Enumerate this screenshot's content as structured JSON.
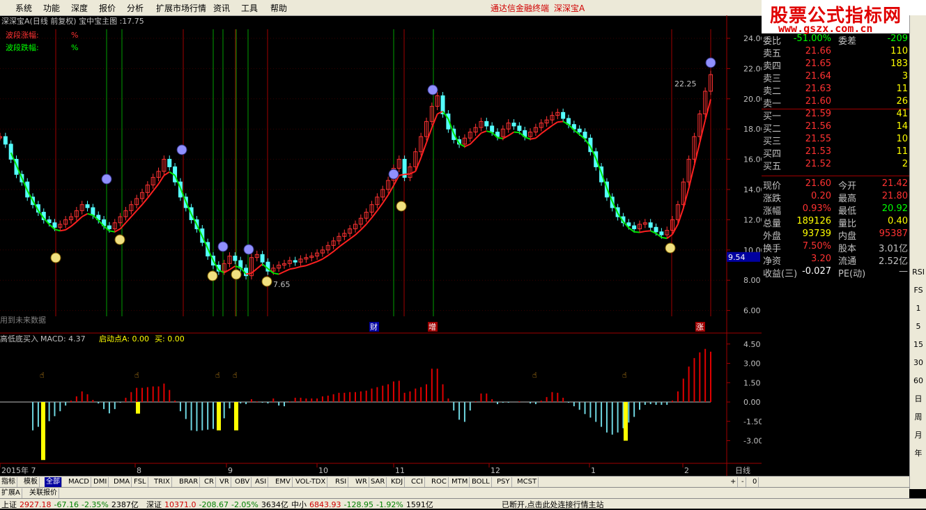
{
  "menu": [
    "系统",
    "功能",
    "深度",
    "报价",
    "分析",
    "扩展市场行情",
    "资讯",
    "工具",
    "帮助"
  ],
  "menu_center": [
    "通达信金融终端",
    "深深宝A"
  ],
  "logo": {
    "title": "股票公式指标网",
    "url": "www.gszx.com.cn"
  },
  "chart_title": "深深宝A(日线 前复权) 宝中宝主图 :17.75",
  "indicator_labels": [
    {
      "label": "波段涨幅:",
      "value": "%"
    },
    {
      "label": "波段跌幅:",
      "value": "%"
    }
  ],
  "future_data_note": "用到未来数据",
  "price_axis": [
    "24.00",
    "22.00",
    "20.00",
    "18.00",
    "16.00",
    "14.00",
    "12.00",
    "10.00",
    "8.00",
    "6.00"
  ],
  "current_price_tag": "9.54",
  "high_label": "22.25",
  "low_label": "7.65",
  "bottom_markers": [
    "财",
    "增",
    "涨"
  ],
  "sub_title": {
    "name": "高低底买入",
    "macd": "MACD: 4.37",
    "start": "启动点A: 0.00",
    "buy": "买: 0.00"
  },
  "sub_axis": [
    "4.50",
    "3.00",
    "1.50",
    "0.00",
    "-1.50",
    "-3.00"
  ],
  "date_axis": [
    "2015年 7",
    "8",
    "9",
    "10",
    "11",
    "12",
    "1",
    "2"
  ],
  "period_label": "日线",
  "quote_rows": [
    {
      "l": "委比",
      "v": "-51.00%",
      "r": "委差",
      "rv": "-209"
    },
    {
      "l": "卖五",
      "v": "21.66",
      "n": "110"
    },
    {
      "l": "卖四",
      "v": "21.65",
      "n": "183"
    },
    {
      "l": "卖三",
      "v": "21.64",
      "n": "3"
    },
    {
      "l": "卖二",
      "v": "21.63",
      "n": "11"
    },
    {
      "l": "卖一",
      "v": "21.60",
      "n": "26"
    },
    {
      "l": "买一",
      "v": "21.59",
      "n": "41"
    },
    {
      "l": "买二",
      "v": "21.56",
      "n": "14"
    },
    {
      "l": "买三",
      "v": "21.55",
      "n": "10"
    },
    {
      "l": "买四",
      "v": "21.53",
      "n": "11"
    },
    {
      "l": "买五",
      "v": "21.52",
      "n": "2"
    }
  ],
  "stats_rows": [
    {
      "l": "现价",
      "v": "21.60",
      "r": "今开",
      "rv": "21.42"
    },
    {
      "l": "涨跌",
      "v": "0.20",
      "r": "最高",
      "rv": "21.80"
    },
    {
      "l": "涨幅",
      "v": "0.93%",
      "r": "最低",
      "rv": "20.92"
    },
    {
      "l": "总量",
      "v": "189126",
      "r": "量比",
      "rv": "0.40"
    },
    {
      "l": "外盘",
      "v": "93739",
      "r": "内盘",
      "rv": "95387"
    },
    {
      "l": "换手",
      "v": "7.50%",
      "r": "股本",
      "rv": "3.01亿"
    },
    {
      "l": "净资",
      "v": "3.20",
      "r": "流通",
      "rv": "2.52亿"
    },
    {
      "l": "收益(三)",
      "v": "-0.027",
      "r": "PE(动)",
      "rv": "—"
    }
  ],
  "tabs": [
    "指标",
    "模板",
    "全部",
    "MACD",
    "DMI",
    "DMA",
    "FSL",
    "TRIX",
    "BRAR",
    "CR",
    "VR",
    "OBV",
    "ASI",
    "EMV",
    "VOL-TDX",
    "RSI",
    "WR",
    "SAR",
    "KDJ",
    "CCI",
    "ROC",
    "MTM",
    "BOLL",
    "PSY",
    "MCST"
  ],
  "tabs2": [
    "扩展A",
    "关联报价"
  ],
  "tab_nav": [
    "+",
    "-",
    "0"
  ],
  "right_toolbar": [
    "RSI",
    "FS",
    "1",
    "5",
    "15",
    "30",
    "60",
    "日",
    "周",
    "月",
    "年"
  ],
  "status": [
    {
      "t": "上证",
      "v": "2927.18",
      "c": "-67.16",
      "p": "-2.35%",
      "a": "2387亿"
    },
    {
      "t": "深证",
      "v": "10371.0",
      "c": "-208.67",
      "p": "-2.05%",
      "a": "3634亿"
    },
    {
      "t": "中小",
      "v": "6843.93",
      "c": "-128.95",
      "p": "-1.92%",
      "a": "1591亿"
    }
  ],
  "status_msg": "已断开,点击此处连接行情主站",
  "chart_data": {
    "type": "candlestick",
    "ylim": [
      5,
      25
    ],
    "sub_ylim": [
      -4,
      5
    ]
  },
  "colors": {
    "up": "#ff3232",
    "down": "#54ffff",
    "support": "#ff0000",
    "resist": "#00ff00",
    "accent": "#ffff00"
  }
}
